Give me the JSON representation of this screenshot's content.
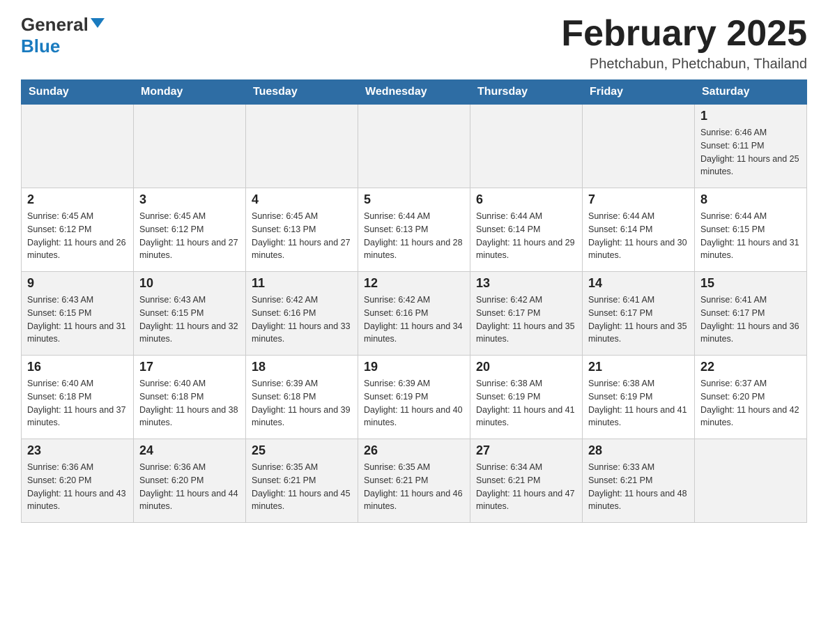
{
  "logo": {
    "general": "General",
    "blue": "Blue"
  },
  "title": "February 2025",
  "location": "Phetchabun, Phetchabun, Thailand",
  "days_of_week": [
    "Sunday",
    "Monday",
    "Tuesday",
    "Wednesday",
    "Thursday",
    "Friday",
    "Saturday"
  ],
  "weeks": [
    [
      {
        "day": "",
        "info": ""
      },
      {
        "day": "",
        "info": ""
      },
      {
        "day": "",
        "info": ""
      },
      {
        "day": "",
        "info": ""
      },
      {
        "day": "",
        "info": ""
      },
      {
        "day": "",
        "info": ""
      },
      {
        "day": "1",
        "info": "Sunrise: 6:46 AM\nSunset: 6:11 PM\nDaylight: 11 hours and 25 minutes."
      }
    ],
    [
      {
        "day": "2",
        "info": "Sunrise: 6:45 AM\nSunset: 6:12 PM\nDaylight: 11 hours and 26 minutes."
      },
      {
        "day": "3",
        "info": "Sunrise: 6:45 AM\nSunset: 6:12 PM\nDaylight: 11 hours and 27 minutes."
      },
      {
        "day": "4",
        "info": "Sunrise: 6:45 AM\nSunset: 6:13 PM\nDaylight: 11 hours and 27 minutes."
      },
      {
        "day": "5",
        "info": "Sunrise: 6:44 AM\nSunset: 6:13 PM\nDaylight: 11 hours and 28 minutes."
      },
      {
        "day": "6",
        "info": "Sunrise: 6:44 AM\nSunset: 6:14 PM\nDaylight: 11 hours and 29 minutes."
      },
      {
        "day": "7",
        "info": "Sunrise: 6:44 AM\nSunset: 6:14 PM\nDaylight: 11 hours and 30 minutes."
      },
      {
        "day": "8",
        "info": "Sunrise: 6:44 AM\nSunset: 6:15 PM\nDaylight: 11 hours and 31 minutes."
      }
    ],
    [
      {
        "day": "9",
        "info": "Sunrise: 6:43 AM\nSunset: 6:15 PM\nDaylight: 11 hours and 31 minutes."
      },
      {
        "day": "10",
        "info": "Sunrise: 6:43 AM\nSunset: 6:15 PM\nDaylight: 11 hours and 32 minutes."
      },
      {
        "day": "11",
        "info": "Sunrise: 6:42 AM\nSunset: 6:16 PM\nDaylight: 11 hours and 33 minutes."
      },
      {
        "day": "12",
        "info": "Sunrise: 6:42 AM\nSunset: 6:16 PM\nDaylight: 11 hours and 34 minutes."
      },
      {
        "day": "13",
        "info": "Sunrise: 6:42 AM\nSunset: 6:17 PM\nDaylight: 11 hours and 35 minutes."
      },
      {
        "day": "14",
        "info": "Sunrise: 6:41 AM\nSunset: 6:17 PM\nDaylight: 11 hours and 35 minutes."
      },
      {
        "day": "15",
        "info": "Sunrise: 6:41 AM\nSunset: 6:17 PM\nDaylight: 11 hours and 36 minutes."
      }
    ],
    [
      {
        "day": "16",
        "info": "Sunrise: 6:40 AM\nSunset: 6:18 PM\nDaylight: 11 hours and 37 minutes."
      },
      {
        "day": "17",
        "info": "Sunrise: 6:40 AM\nSunset: 6:18 PM\nDaylight: 11 hours and 38 minutes."
      },
      {
        "day": "18",
        "info": "Sunrise: 6:39 AM\nSunset: 6:18 PM\nDaylight: 11 hours and 39 minutes."
      },
      {
        "day": "19",
        "info": "Sunrise: 6:39 AM\nSunset: 6:19 PM\nDaylight: 11 hours and 40 minutes."
      },
      {
        "day": "20",
        "info": "Sunrise: 6:38 AM\nSunset: 6:19 PM\nDaylight: 11 hours and 41 minutes."
      },
      {
        "day": "21",
        "info": "Sunrise: 6:38 AM\nSunset: 6:19 PM\nDaylight: 11 hours and 41 minutes."
      },
      {
        "day": "22",
        "info": "Sunrise: 6:37 AM\nSunset: 6:20 PM\nDaylight: 11 hours and 42 minutes."
      }
    ],
    [
      {
        "day": "23",
        "info": "Sunrise: 6:36 AM\nSunset: 6:20 PM\nDaylight: 11 hours and 43 minutes."
      },
      {
        "day": "24",
        "info": "Sunrise: 6:36 AM\nSunset: 6:20 PM\nDaylight: 11 hours and 44 minutes."
      },
      {
        "day": "25",
        "info": "Sunrise: 6:35 AM\nSunset: 6:21 PM\nDaylight: 11 hours and 45 minutes."
      },
      {
        "day": "26",
        "info": "Sunrise: 6:35 AM\nSunset: 6:21 PM\nDaylight: 11 hours and 46 minutes."
      },
      {
        "day": "27",
        "info": "Sunrise: 6:34 AM\nSunset: 6:21 PM\nDaylight: 11 hours and 47 minutes."
      },
      {
        "day": "28",
        "info": "Sunrise: 6:33 AM\nSunset: 6:21 PM\nDaylight: 11 hours and 48 minutes."
      },
      {
        "day": "",
        "info": ""
      }
    ]
  ]
}
